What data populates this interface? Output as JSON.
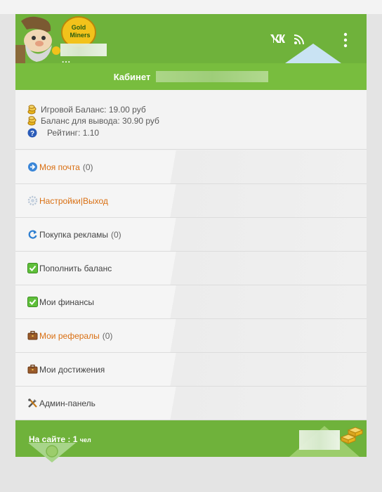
{
  "header": {
    "logo_text_line1": "Gold",
    "logo_text_line2": "Miners",
    "username_suffix": "..."
  },
  "cabinet": {
    "title": "Кабинет"
  },
  "stats": {
    "game_balance": "Игровой Баланс: 19.00 руб",
    "withdraw_balance": "Баланс для вывода: 30.90 руб",
    "rating": "Рейтинг: 1.10"
  },
  "menu": [
    {
      "label": "Моя почта",
      "count": "(0)",
      "icon": "arrow-circle-icon",
      "highlight": true
    },
    {
      "label": "Настройки|Выход",
      "count": "",
      "icon": "settings-icon",
      "highlight": true
    },
    {
      "label": "Покупка рекламы",
      "count": "(0)",
      "icon": "refresh-icon",
      "highlight": false
    },
    {
      "label": "Пополнить баланс",
      "count": "",
      "icon": "check-icon",
      "highlight": false
    },
    {
      "label": "Мои финансы",
      "count": "",
      "icon": "check-icon",
      "highlight": false
    },
    {
      "label": "Мои рефералы",
      "count": "(0)",
      "icon": "briefcase-icon",
      "highlight": true
    },
    {
      "label": "Мои достижения",
      "count": "",
      "icon": "briefcase-icon",
      "highlight": false
    },
    {
      "label": "Админ-панель",
      "count": "",
      "icon": "tools-icon",
      "highlight": false
    }
  ],
  "footer": {
    "online_label": "На сайте : 1",
    "online_unit": "чел"
  },
  "colors": {
    "brand_green": "#6fb23b",
    "link_orange": "#d96f12"
  }
}
